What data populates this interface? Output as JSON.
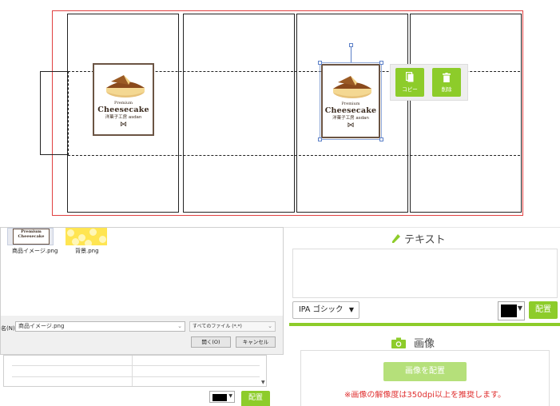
{
  "canvas": {
    "product_card": {
      "premium": "Premium",
      "title": "Cheesecake",
      "shop": "洋菓子工房 asdan",
      "bow": "⋈"
    },
    "context_menu": {
      "copy_label": "コピー",
      "delete_label": "削除"
    }
  },
  "file_dialog": {
    "files": [
      {
        "name": "商品イメージ.png"
      },
      {
        "name": "背景.png"
      }
    ],
    "thumb_text": "Premium Cheesecake",
    "filename_label": "名(N):",
    "filename_value": "商品イメージ.png",
    "filetype_value": "すべてのファイル (*.*)",
    "open_label": "開く(O)",
    "cancel_label": "キャンセル"
  },
  "left_panel": {
    "place_label": "配置"
  },
  "text_section": {
    "title": "テキスト",
    "font_value": "IPA ゴシック",
    "place_label": "配置"
  },
  "image_section": {
    "title": "画像",
    "place_button": "画像を配置",
    "notice": "※画像の解像度は350dpi以上を推奨します。"
  },
  "colors": {
    "accent_green": "#8dcc2a",
    "frame_red": "#e04040",
    "notice_red": "#e03030"
  },
  "icons": [
    "pen-icon",
    "camera-icon",
    "copy-icon",
    "trash-icon",
    "dropdown-arrow-icon"
  ]
}
